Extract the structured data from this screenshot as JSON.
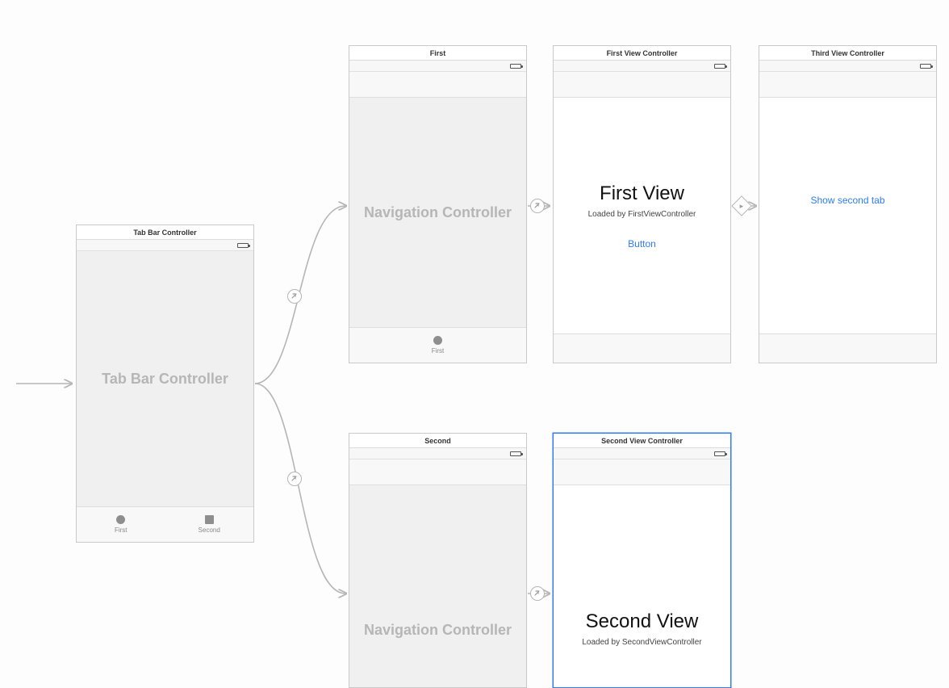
{
  "entry_arrow": true,
  "scenes": {
    "tabBarController": {
      "title": "Tab Bar Controller",
      "placeholder": "Tab Bar Controller",
      "tabs": [
        {
          "label": "First",
          "icon": "circle"
        },
        {
          "label": "Second",
          "icon": "square"
        }
      ]
    },
    "navFirst": {
      "title": "First",
      "placeholder": "Navigation Controller",
      "tabs": [
        {
          "label": "First",
          "icon": "circle"
        }
      ]
    },
    "navSecond": {
      "title": "Second",
      "placeholder": "Navigation Controller"
    },
    "firstVC": {
      "title": "First View Controller",
      "heading": "First View",
      "subheading": "Loaded by FirstViewController",
      "buttonLabel": "Button"
    },
    "secondVC": {
      "title": "Second View Controller",
      "heading": "Second View",
      "subheading": "Loaded by SecondViewController"
    },
    "thirdVC": {
      "title": "Third View Controller",
      "buttonLabel": "Show second tab"
    }
  },
  "segues": [
    {
      "from": "tabBarController",
      "to": "navFirst",
      "kind": "relationship"
    },
    {
      "from": "tabBarController",
      "to": "navSecond",
      "kind": "relationship"
    },
    {
      "from": "navFirst",
      "to": "firstVC",
      "kind": "relationship"
    },
    {
      "from": "navSecond",
      "to": "secondVC",
      "kind": "relationship"
    },
    {
      "from": "firstVC",
      "to": "thirdVC",
      "kind": "show"
    }
  ]
}
